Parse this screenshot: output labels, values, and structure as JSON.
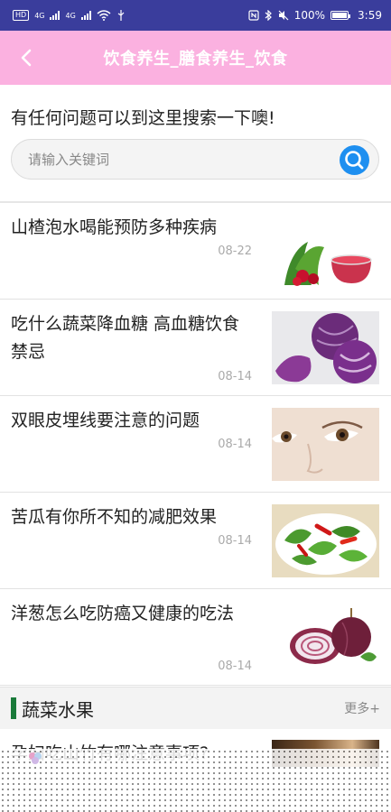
{
  "status_bar": {
    "left_chip": "HD",
    "net1": "4G",
    "net2": "4G",
    "battery": "100%",
    "time": "3:59"
  },
  "header": {
    "title": "饮食养生_膳食养生_饮食"
  },
  "search": {
    "prompt": "有任何问题可以到这里搜索一下噢!",
    "placeholder": "请输入关键词"
  },
  "articles": [
    {
      "title": "山楂泡水喝能预防多种疾病",
      "date": "08-22",
      "image": "hawthorn-tea-image"
    },
    {
      "title": "吃什么蔬菜降血糖 高血糖饮食禁忌",
      "date": "08-14",
      "image": "purple-cabbage-image"
    },
    {
      "title": "双眼皮埋线要注意的问题",
      "date": "08-14",
      "image": "eye-closeup-image"
    },
    {
      "title": "苦瓜有你所不知的减肥效果",
      "date": "08-14",
      "image": "bitter-melon-dish-image"
    },
    {
      "title": "洋葱怎么吃防癌又健康的吃法",
      "date": "08-14",
      "image": "red-onion-image"
    }
  ],
  "section": {
    "title": "蔬菜水果",
    "more": "更多+"
  },
  "partial_article": {
    "title": "孕妇吃山竹有哪注意事项?"
  },
  "colors": {
    "status_bar": "#3a3d9c",
    "header": "#fbb1e0",
    "search_button": "#1e8ff0",
    "section_accent": "#1a7a3a"
  }
}
